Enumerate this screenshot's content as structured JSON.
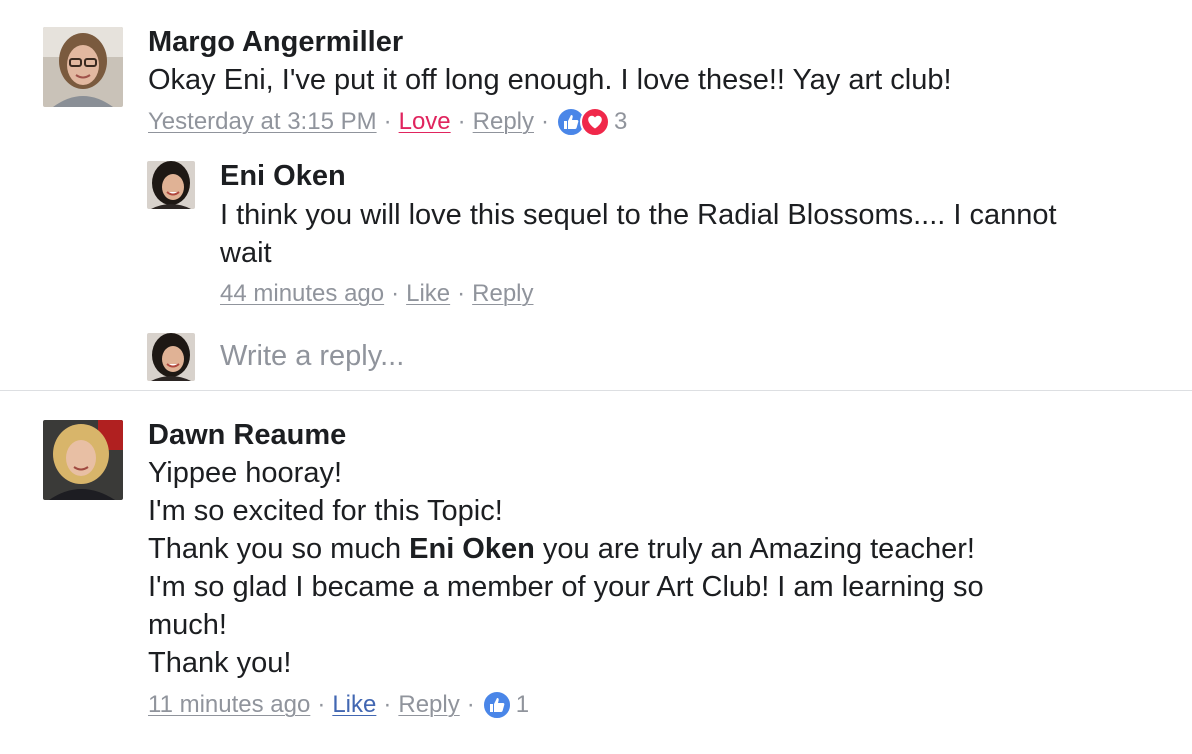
{
  "comments": [
    {
      "author": "Margo Angermiller",
      "text": "Okay Eni, I've put it off long enough. I love these!! Yay art club!",
      "time": "Yesterday at 3:15 PM",
      "reaction_action": "Love",
      "reply_action": "Reply",
      "reaction_count": "3",
      "reply": {
        "author": "Eni Oken",
        "text_line1": "I think you will love this sequel to the Radial Blossoms.... I cannot",
        "text_line2": "wait",
        "time": "44 minutes ago",
        "like_action": "Like",
        "reply_action": "Reply"
      },
      "write_reply_placeholder": "Write a reply..."
    },
    {
      "author": "Dawn Reaume",
      "lines": {
        "l1": "Yippee hooray!",
        "l2": "I'm so excited for this Topic!",
        "l3_before": "Thank you so much ",
        "l3_mention": "Eni Oken",
        "l3_after": " you are truly an Amazing teacher!",
        "l4": "I'm so glad I became a member of your Art Club! I am learning so",
        "l5": "much!",
        "l6": "Thank you!"
      },
      "time": "11 minutes ago",
      "like_action": "Like",
      "reply_action": "Reply",
      "reaction_count": "1"
    }
  ],
  "separator": "·",
  "colors": {
    "like_blue": "#4a86e8",
    "love_red": "#e0245e",
    "meta_gray": "#90949c",
    "divider": "#dddfe2"
  },
  "icons": {
    "like_reaction": "thumbs-up-icon",
    "love_reaction": "heart-icon"
  }
}
